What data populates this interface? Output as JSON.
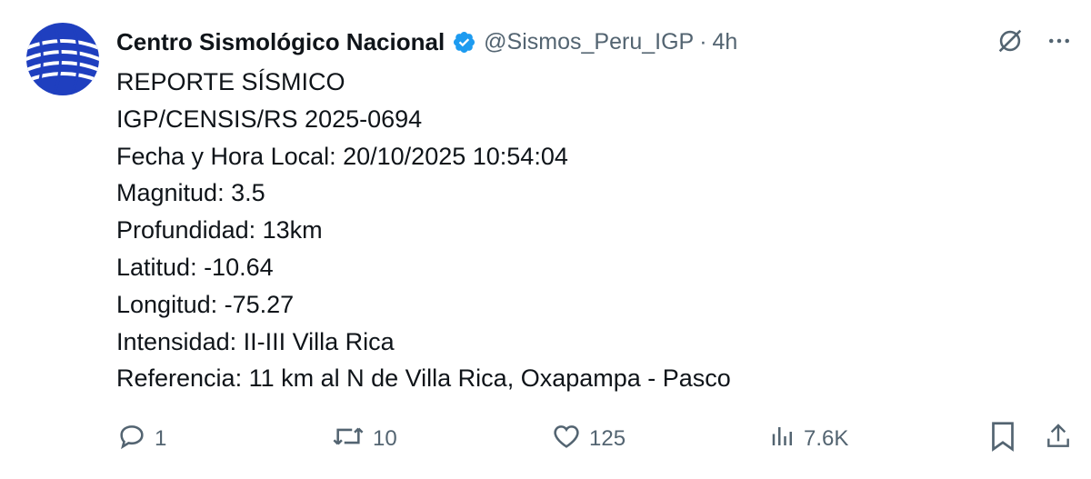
{
  "tweet": {
    "author_name": "Centro Sismológico Nacional",
    "handle": "@Sismos_Peru_IGP",
    "separator": "·",
    "time": "4h",
    "lines": [
      "REPORTE SÍSMICO",
      "IGP/CENSIS/RS 2025-0694",
      "Fecha y Hora Local: 20/10/2025 10:54:04",
      "Magnitud: 3.5",
      "Profundidad: 13km",
      "Latitud: -10.64",
      "Longitud: -75.27",
      "Intensidad: II-III Villa Rica",
      "Referencia: 11 km al N de Villa Rica, Oxapampa - Pasco"
    ]
  },
  "metrics": {
    "replies": "1",
    "reposts": "10",
    "likes": "125",
    "views": "7.6K"
  },
  "colors": {
    "text": "#0f1419",
    "secondary": "#536471",
    "verified": "#1d9bf0",
    "avatar_blue": "#1f3fbf"
  },
  "icons": [
    "verified-badge-icon",
    "grok-icon",
    "more-icon",
    "reply-icon",
    "repost-icon",
    "like-icon",
    "views-icon",
    "bookmark-icon",
    "share-icon"
  ]
}
